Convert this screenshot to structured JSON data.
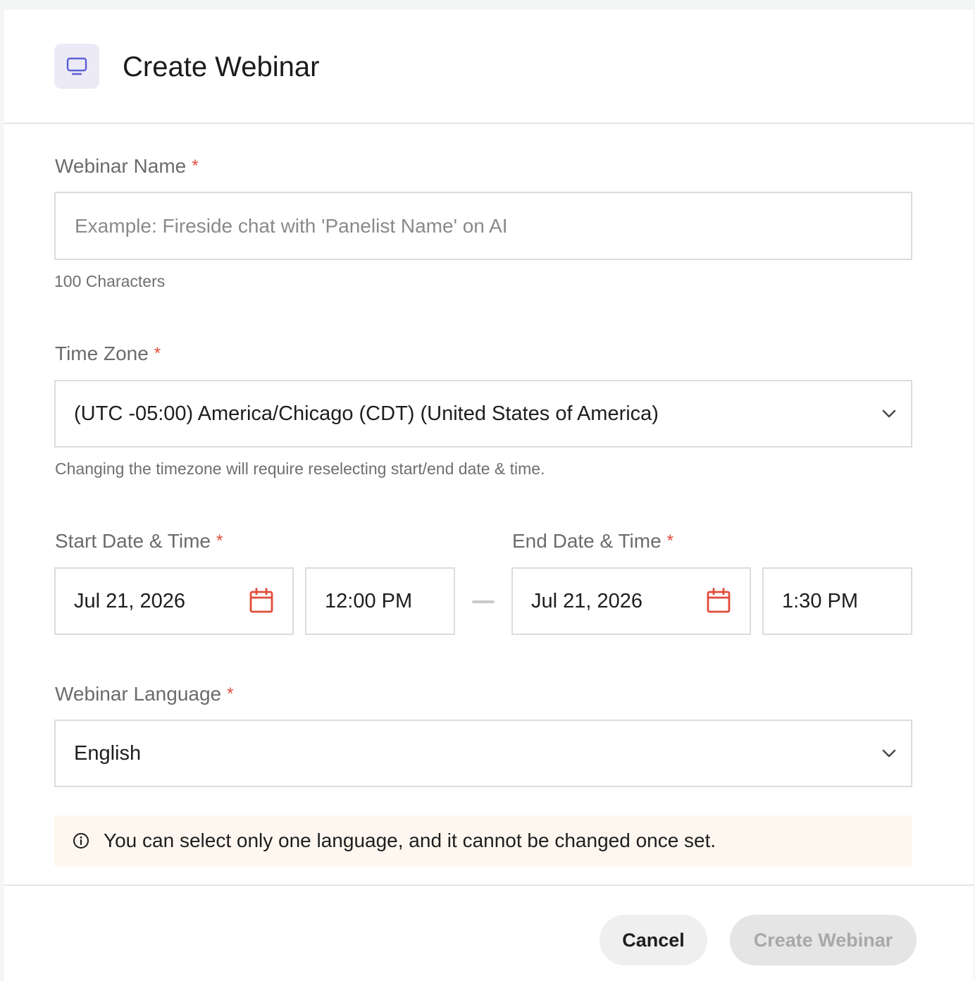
{
  "dialog": {
    "title": "Create Webinar",
    "header_icon": "monitor-icon"
  },
  "webinar_name": {
    "label": "Webinar Name",
    "required_mark": "*",
    "placeholder": "Example: Fireside chat with 'Panelist Name' on AI",
    "value": "",
    "helper": "100 Characters"
  },
  "time_zone": {
    "label": "Time Zone",
    "required_mark": "*",
    "selected": "(UTC -05:00) America/Chicago (CDT) (United States of America)",
    "helper": "Changing the timezone will require reselecting start/end date & time.",
    "dropdown_icon": "chevron-down-icon"
  },
  "start": {
    "label": "Start Date & Time",
    "required_mark": "*",
    "date": "Jul 21, 2026",
    "time": "12:00 PM",
    "date_icon": "calendar-icon"
  },
  "end": {
    "label": "End Date & Time",
    "required_mark": "*",
    "date": "Jul 21, 2026",
    "time": "1:30 PM",
    "date_icon": "calendar-icon"
  },
  "language": {
    "label": "Webinar Language",
    "required_mark": "*",
    "selected": "English",
    "dropdown_icon": "chevron-down-icon"
  },
  "notice": {
    "icon": "info-icon",
    "text": "You can select only one language, and it cannot be changed once set."
  },
  "footer": {
    "cancel_label": "Cancel",
    "create_label": "Create Webinar"
  },
  "colors": {
    "required": "#e24c3b",
    "calendar_icon": "#e24c3b",
    "header_icon": "#5b5fd6",
    "notice_bg": "#fdf7ef",
    "disabled_button_bg": "#e5e5e5",
    "disabled_button_text": "#a8a8a8"
  }
}
